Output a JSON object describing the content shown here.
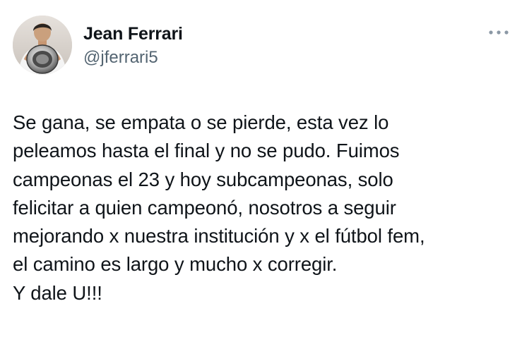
{
  "author": {
    "display_name": "Jean Ferrari",
    "handle": "@jferrari5"
  },
  "icons": {
    "avatar": "profile-photo",
    "more": "more-dots-icon"
  },
  "tweet": {
    "text": "Se gana, se empata o se pierde, esta vez lo\npeleamos hasta el final y no se pudo. Fuimos\ncampeonas el 23 y hoy subcampeonas, solo\nfelicitar a quien campeonó, nosotros a seguir\nmejorando x nuestra institución y x el fútbol fem,\nel camino es largo y mucho x corregir.\nY dale U!!!"
  },
  "colors": {
    "text_primary": "#0f1419",
    "text_secondary": "#536471",
    "background": "#ffffff"
  }
}
